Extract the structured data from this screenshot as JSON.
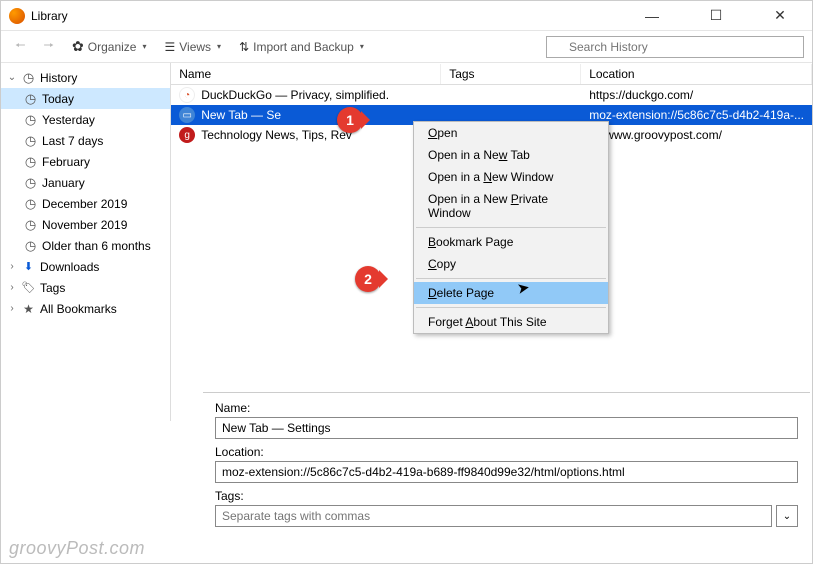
{
  "window": {
    "title": "Library"
  },
  "toolbar": {
    "organize": "Organize",
    "views": "Views",
    "import": "Import and Backup",
    "search_placeholder": "Search History"
  },
  "sidebar": {
    "history": "History",
    "items": [
      {
        "label": "Today"
      },
      {
        "label": "Yesterday"
      },
      {
        "label": "Last 7 days"
      },
      {
        "label": "February"
      },
      {
        "label": "January"
      },
      {
        "label": "December 2019"
      },
      {
        "label": "November 2019"
      },
      {
        "label": "Older than 6 months"
      }
    ],
    "downloads": "Downloads",
    "tags": "Tags",
    "bookmarks": "All Bookmarks"
  },
  "columns": {
    "name": "Name",
    "tags": "Tags",
    "location": "Location"
  },
  "rows": [
    {
      "name": "DuckDuckGo — Privacy, simplified.",
      "location": "https://duckgo.com/",
      "iconbg": "#fff",
      "iconfg": "#d9502a",
      "glyph": "◔"
    },
    {
      "name": "New Tab — Se",
      "location": "moz-extension://5c86c7c5-d4b2-419a-...",
      "iconbg": "#3f84d6",
      "iconfg": "#fff",
      "glyph": "▭"
    },
    {
      "name": "Technology News, Tips, Rev",
      "location": "s://www.groovypost.com/",
      "iconbg": "#c11c1c",
      "iconfg": "#fff",
      "glyph": "g"
    }
  ],
  "context": {
    "open": "pen",
    "newtab_a": "Open in a Ne",
    "newtab_b": " Tab",
    "newwin_a": "Open in a ",
    "newwin_b": "ew Window",
    "priv": "Open in a New ",
    "priv_b": "rivate Window",
    "bookmark_b": "ookmark Page",
    "copy_b": "opy",
    "delete_b": "elete Page",
    "forget": "Forget ",
    "forget_b": "bout This Site"
  },
  "details": {
    "name_label": "Name:",
    "name_value": "New Tab — Settings",
    "loc_label": "Location:",
    "loc_value": "moz-extension://5c86c7c5-d4b2-419a-b689-ff9840d99e32/html/options.html",
    "tags_label": "Tags:",
    "tags_placeholder": "Separate tags with commas"
  },
  "callouts": {
    "one": "1",
    "two": "2"
  },
  "watermark": "groovyPost.com"
}
